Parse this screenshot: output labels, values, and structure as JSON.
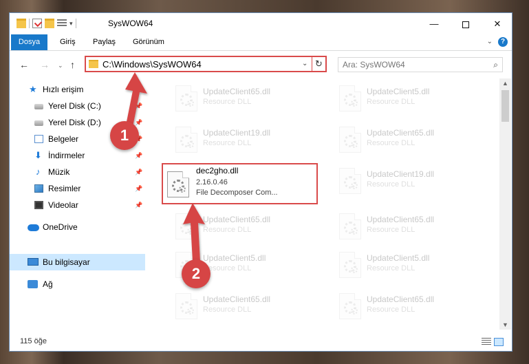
{
  "window": {
    "title": "SysWOW64",
    "minimize": "—",
    "close": "✕"
  },
  "ribbon": {
    "tabs": [
      "Dosya",
      "Giriş",
      "Paylaş",
      "Görünüm"
    ],
    "help": "?",
    "file_tab_color": "#1979ca"
  },
  "nav": {
    "back": "←",
    "forward": "→",
    "recent": "⌄",
    "up": "↑",
    "address": "C:\\Windows\\SysWOW64",
    "dropdown": "⌄",
    "refresh": "↻",
    "search_placeholder": "Ara: SysWOW64",
    "search_icon": "⌕"
  },
  "sidebar": {
    "items": [
      {
        "label": "Hızlı erişim",
        "icon": "star-icon",
        "glyph": "★"
      },
      {
        "label": "Yerel Disk (C:)",
        "icon": "drive-icon"
      },
      {
        "label": "Yerel Disk (D:)",
        "icon": "drive-icon"
      },
      {
        "label": "Belgeler",
        "icon": "document-icon"
      },
      {
        "label": "İndirmeler",
        "icon": "download-icon",
        "glyph": "⬇"
      },
      {
        "label": "Müzik",
        "icon": "music-icon",
        "glyph": "♪"
      },
      {
        "label": "Resimler",
        "icon": "pictures-icon"
      },
      {
        "label": "Videolar",
        "icon": "video-icon"
      },
      {
        "label": "OneDrive",
        "icon": "cloud-icon"
      },
      {
        "label": "Bu bilgisayar",
        "icon": "computer-icon",
        "selected": true
      },
      {
        "label": "Ağ",
        "icon": "network-icon"
      }
    ],
    "pin_glyph": "📌"
  },
  "files": {
    "left_column": [
      {
        "name": "UpdateClient65.dll",
        "type": "Resource DLL"
      },
      {
        "name": "UpdateClient19.dll",
        "type": "Resource DLL"
      },
      {
        "name": "dec2gho.dll",
        "version": "2.16.0.46",
        "description": "File Decomposer Com..."
      },
      {
        "name": "UpdateClient65.dll",
        "type": "Resource DLL"
      },
      {
        "name": "UpdateClient5.dll",
        "type": "Resource DLL"
      },
      {
        "name": "UpdateClient65.dll",
        "type": "Resource DLL"
      }
    ],
    "right_column": [
      {
        "name": "UpdateClient5.dll",
        "type": "Resource DLL"
      },
      {
        "name": "UpdateClient65.dll",
        "type": "Resource DLL"
      },
      {
        "name": "UpdateClient19.dll",
        "type": "Resource DLL"
      },
      {
        "name": "UpdateClient65.dll",
        "type": "Resource DLL"
      },
      {
        "name": "UpdateClient5.dll",
        "type": "Resource DLL"
      },
      {
        "name": "UpdateClient65.dll",
        "type": "Resource DLL"
      }
    ]
  },
  "status": {
    "count": "115 öğe"
  },
  "annotations": {
    "step1": "1",
    "step2": "2",
    "color": "#d64545"
  }
}
